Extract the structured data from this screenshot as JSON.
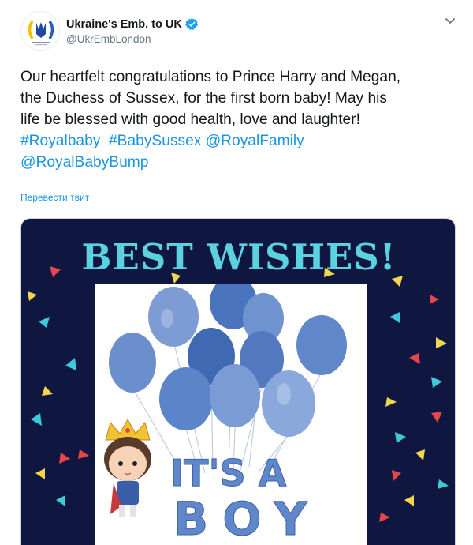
{
  "account": {
    "display_name": "Ukraine's Emb. to UK",
    "handle": "@UkrEmbLondon",
    "verified_icon": "verified-badge-icon",
    "avatar_caption": "Ukrainian Embassy London"
  },
  "tweet": {
    "text_lines": [
      "Our heartfelt congratulations to Prince Harry and Megan,",
      "the Duchess of Sussex, for the first born baby! May his",
      "life be blessed with good health, love and laughter!"
    ],
    "tags_line1": [
      "#Royalbaby",
      "#BabySussex",
      "@RoyalFamily"
    ],
    "tags_line2": [
      "@RoyalBabyBump"
    ],
    "translate_label": "Перевести твит"
  },
  "media": {
    "heading": "BEST WISHES!",
    "photo_text_line1": "IT'S A",
    "photo_text_line2": "BOY",
    "colors": {
      "background": "#0f1741",
      "heading": "#5ad2e0",
      "balloon": "#5f87c9",
      "link": "#1b95e0"
    }
  }
}
